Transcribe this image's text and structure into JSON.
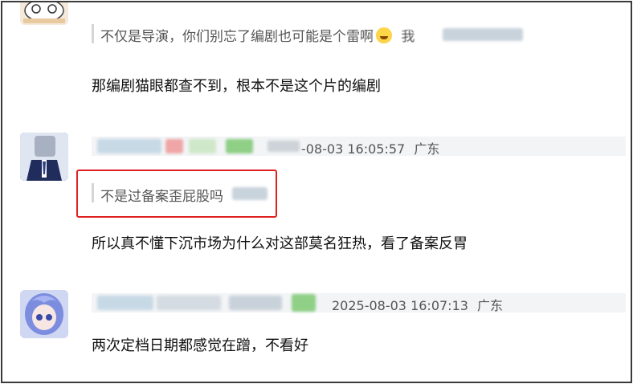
{
  "comments": [
    {
      "quote": "不仅是导演，你们别忘了编剧也可能是个雷啊",
      "quote_emoji": "laughing-emoji",
      "quote_suffix": "我",
      "reply": "那编剧猫眼都查不到，根本不是这个片的编剧"
    },
    {
      "timestamp": "-08-03 16:05:57",
      "location": "广东",
      "quote": "不是过备案歪屁股吗",
      "reply": "所以真不懂下沉市场为什么对这部莫名狂热，看了备案反胃",
      "highlight_color": "#e02020"
    },
    {
      "timestamp": "2025-08-03 16:07:13",
      "location": "广东",
      "reply": "两次定档日期都感觉在蹭，不看好"
    }
  ]
}
